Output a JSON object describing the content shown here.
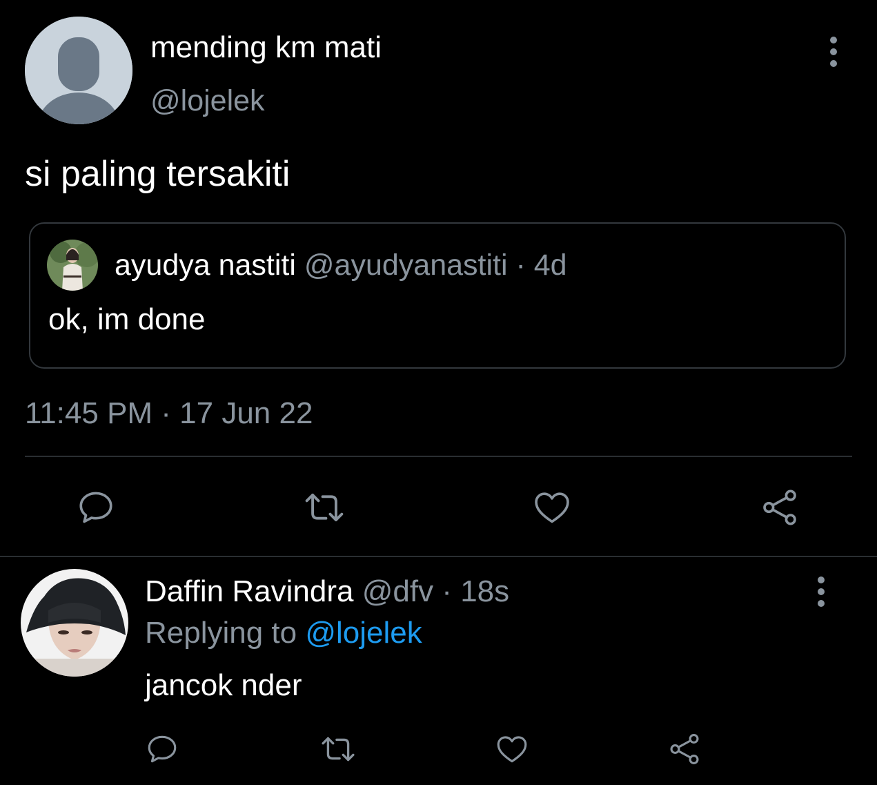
{
  "tweet": {
    "author_name": "mending km mati",
    "author_handle": "@lojelek",
    "text": "si paling tersakiti",
    "timestamp": "11:45 PM · 17 Jun 22",
    "more_icon": "more-vertical-icon"
  },
  "quoted_tweet": {
    "author_name": "ayudya nastiti",
    "author_handle": "@ayudyanastiti",
    "separator": " · ",
    "age": "4d",
    "text": "ok, im done"
  },
  "reply": {
    "author_name": "Daffin Ravindra",
    "author_handle": "@dfv",
    "separator": " · ",
    "age": "18s",
    "replying_to_label": "Replying to ",
    "replying_to_handle": "@lojelek",
    "text": "jancok nder",
    "more_icon": "more-vertical-icon"
  },
  "actions": {
    "icons": [
      "reply-icon",
      "retweet-icon",
      "like-icon",
      "share-icon"
    ]
  },
  "colors": {
    "background": "#000000",
    "primary_text": "#ffffff",
    "secondary_text": "#8a949e",
    "link": "#1d9bf0",
    "divider": "#2a2e32",
    "icon": "#8a949e"
  }
}
